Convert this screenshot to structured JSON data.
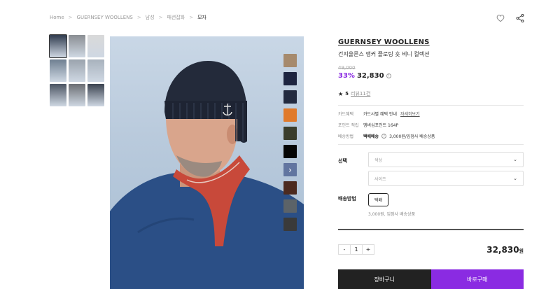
{
  "top_stub": "··· ···",
  "breadcrumb": [
    "Home",
    "GUERNSEY WOOLLENS",
    "남성",
    "패션잡화",
    "모자"
  ],
  "icons": {
    "wishlist": "heart-icon",
    "share": "share-icon",
    "arrow": "chevron-right-icon",
    "dropdown": "chevron-down-icon",
    "star": "star-icon",
    "help": "question-circle-icon"
  },
  "product": {
    "brand": "GUERNSEY WOOLLENS",
    "name": "건지울른스 앵커 플로팅 숏 비니 컬렉션",
    "original_price": "49,000",
    "discount": "33%",
    "price": "32,830",
    "help_mark": "?",
    "rating_star": "★",
    "rating": "5",
    "reviews": "리뷰11건"
  },
  "thumbnails": [
    "#2f3b4e",
    "#8a8e93",
    "#d9d9d9",
    "#6f7f91",
    "#9aa3ad",
    "#a8b2bd",
    "#4c5563",
    "#6c6f74",
    "#3b4350"
  ],
  "swatch_colors": [
    "#a68a6d",
    "#1d2440",
    "#222a3f",
    "#e07a2b",
    "#3a3d2c",
    "#050505",
    "arrow",
    "#4c2a1f",
    "#5c6368",
    "#3a3a3a"
  ],
  "arrow_glyph": "›",
  "meta": {
    "card_label": "카드혜택",
    "card_value": "카드사별 혜택 안내",
    "card_link": "자세히보기",
    "point_label": "포인트 적립",
    "point_value": "멤버십포인트 164P",
    "ship_label": "배송방법",
    "ship_bold": "택배배송",
    "ship_value": "3,000원/입점사 배송상품"
  },
  "options": {
    "label": "선택",
    "color_placeholder": "색상",
    "size_placeholder": "사이즈"
  },
  "shipping": {
    "label": "배송방법",
    "option": "택배",
    "note": "3,000원, 입점사 배송상품"
  },
  "order": {
    "minus": "-",
    "quantity": "1",
    "plus": "+",
    "total": "32,830",
    "currency": "원",
    "cart_label": "장바구니",
    "buy_label": "바로구매"
  },
  "colors": {
    "accent": "#8a2be2",
    "dark_button": "#222222"
  }
}
